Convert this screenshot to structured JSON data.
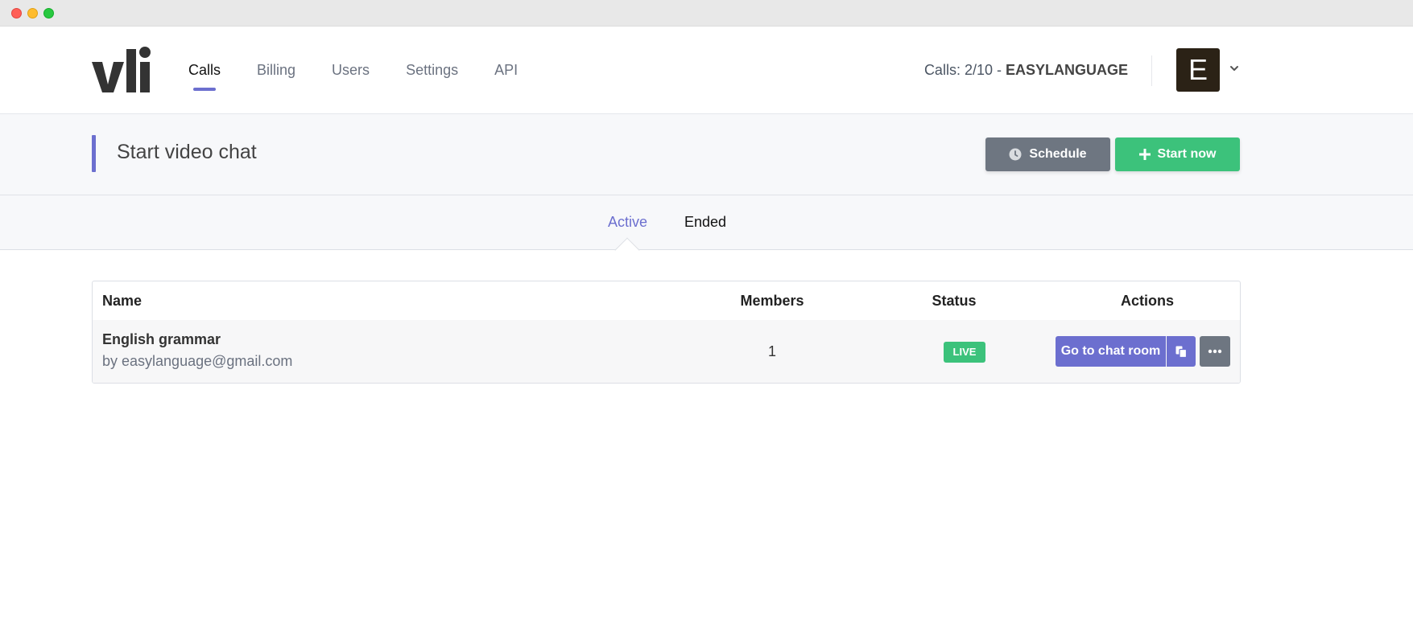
{
  "nav": {
    "items": [
      {
        "label": "Calls",
        "active": true
      },
      {
        "label": "Billing"
      },
      {
        "label": "Users"
      },
      {
        "label": "Settings"
      },
      {
        "label": "API"
      }
    ]
  },
  "account": {
    "calls_prefix": "Calls: 2/10 - ",
    "org_name": "EASYLANGUAGE",
    "avatar_letter": "E"
  },
  "toolbar": {
    "title": "Start video chat",
    "schedule_label": "Schedule",
    "start_label": "Start now"
  },
  "tabs": [
    {
      "label": "Active",
      "active": true
    },
    {
      "label": "Ended"
    }
  ],
  "table": {
    "headers": {
      "name": "Name",
      "members": "Members",
      "status": "Status",
      "actions": "Actions"
    },
    "rows": [
      {
        "name": "English grammar",
        "owner": "by easylanguage@gmail.com",
        "members": "1",
        "status": "LIVE",
        "action_label": "Go to chat room"
      }
    ]
  },
  "colors": {
    "accent": "#6c6fcf",
    "success": "#3cc27b",
    "secondary": "#6e7681"
  }
}
